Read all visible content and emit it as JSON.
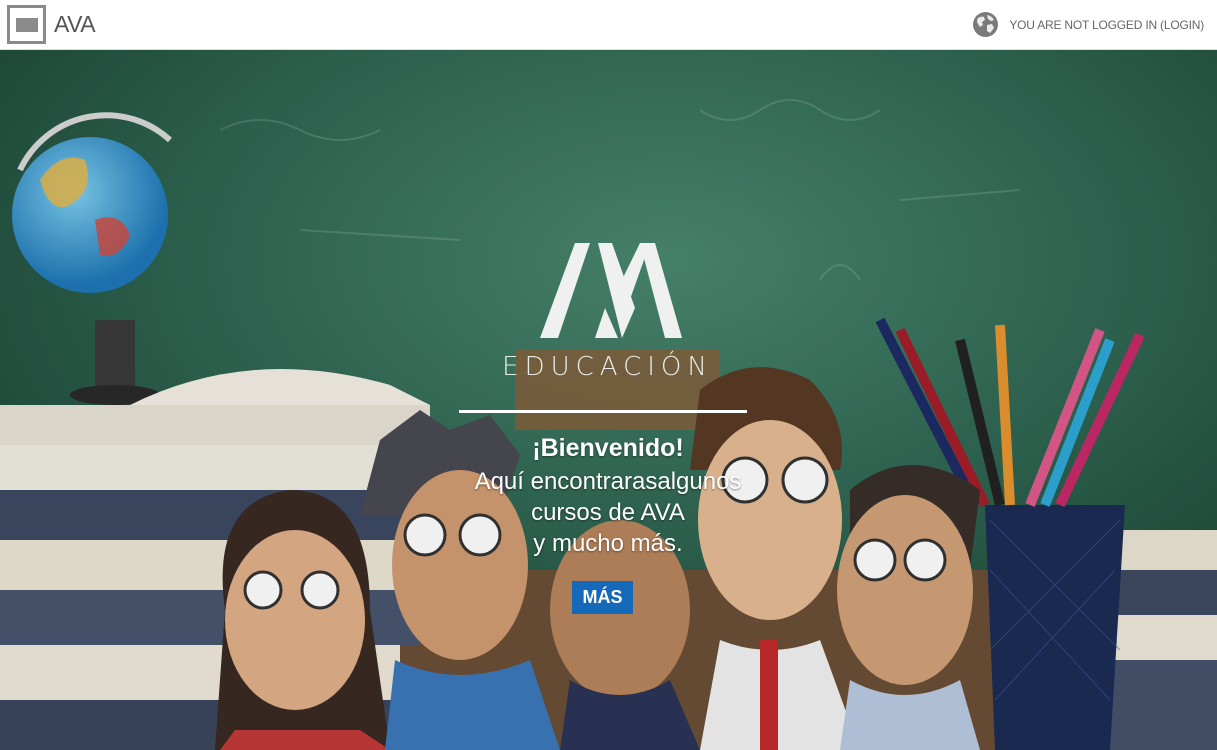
{
  "navbar": {
    "brand_name": "AVA",
    "login_text": "YOU ARE NOT LOGGED IN (LOGIN)"
  },
  "hero": {
    "logo_word": "AVA",
    "logo_subtitle": "EDUCACIÓN",
    "welcome": "¡Bienvenido!",
    "tagline_lines": [
      "Aquí encontrarasalgunos",
      "cursos de AVA",
      "y mucho más."
    ],
    "button_label": "MÁS"
  },
  "colors": {
    "accent": "#1668b8",
    "chalkboard": "#2b5f4c"
  },
  "icons": [
    "ava-logo-icon",
    "globe-icon"
  ]
}
